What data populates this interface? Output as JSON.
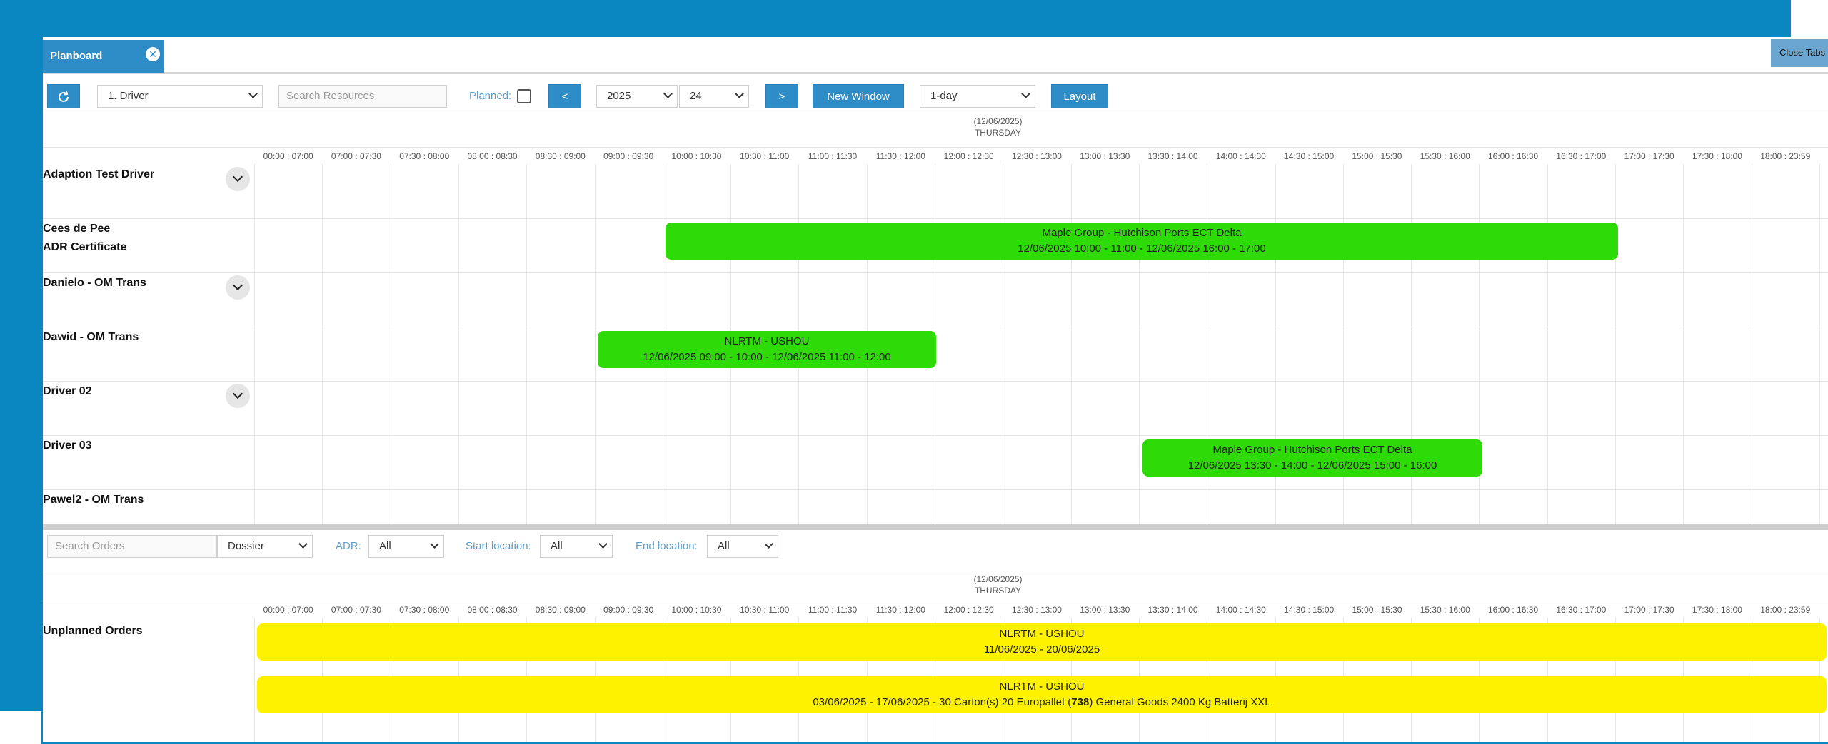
{
  "tab": {
    "title": "Planboard",
    "close_icon": "close-icon"
  },
  "close_tabs_label": "Close Tabs",
  "toolbar": {
    "resource_type": "1. Driver",
    "search_resources_placeholder": "Search Resources",
    "planned_label": "Planned:",
    "prev_label": "<",
    "year": "2025",
    "week": "24",
    "next_label": ">",
    "new_window_label": "New Window",
    "view_mode": "1-day",
    "layout_label": "Layout"
  },
  "date_header": {
    "date": "(12/06/2025)",
    "day": "THURSDAY"
  },
  "time_slots": [
    "00:00 : 07:00",
    "07:00 : 07:30",
    "07:30 : 08:00",
    "08:00 : 08:30",
    "08:30 : 09:00",
    "09:00 : 09:30",
    "10:00 : 10:30",
    "10:30 : 11:00",
    "11:00 : 11:30",
    "11:30 : 12:00",
    "12:00 : 12:30",
    "12:30 : 13:00",
    "13:00 : 13:30",
    "13:30 : 14:00",
    "14:00 : 14:30",
    "14:30 : 15:00",
    "15:00 : 15:30",
    "15:30 : 16:00",
    "16:00 : 16:30",
    "16:30 : 17:00",
    "17:00 : 17:30",
    "17:30 : 18:00",
    "18:00 : 23:59"
  ],
  "resources": [
    {
      "name": "Adaption Test Driver",
      "sub": ""
    },
    {
      "name": "Cees de Pee",
      "sub": "ADR Certificate"
    },
    {
      "name": "Danielo - OM Trans",
      "sub": ""
    },
    {
      "name": "Dawid - OM Trans",
      "sub": ""
    },
    {
      "name": "Driver 02",
      "sub": ""
    },
    {
      "name": "Driver 03",
      "sub": ""
    },
    {
      "name": "Pawel2 - OM Trans",
      "sub": ""
    }
  ],
  "planned_trips": [
    {
      "title": "Maple Group - Hutchison Ports ECT Delta",
      "period": "12/06/2025 10:00 - 11:00 - 12/06/2025 16:00 - 17:00"
    },
    {
      "title": "NLRTM - USHOU",
      "period": "12/06/2025 09:00 - 10:00 - 12/06/2025 11:00 - 12:00"
    },
    {
      "title": "Maple Group - Hutchison Ports ECT Delta",
      "period": "12/06/2025 13:30 - 14:00 - 12/06/2025 15:00 - 16:00"
    }
  ],
  "orders_toolbar": {
    "search_orders_placeholder": "Search Orders",
    "order_type": "Dossier",
    "adr_label": "ADR:",
    "adr_value": "All",
    "start_location_label": "Start location:",
    "start_location_value": "All",
    "end_location_label": "End location:",
    "end_location_value": "All"
  },
  "unplanned": {
    "label": "Unplanned Orders",
    "orders": [
      {
        "title": "NLRTM - USHOU",
        "details_pre": "11/06/2025 - 20/06/2025",
        "details_bold": "",
        "details_post": ""
      },
      {
        "title": "NLRTM - USHOU",
        "details_pre": "03/06/2025 - 17/06/2025 - 30 Carton(s) 20 Europallet (",
        "details_bold": "738",
        "details_post": ") General Goods 2400 Kg Batterij XXL"
      }
    ]
  },
  "colors": {
    "accent": "#2e8cc7",
    "planned_bar": "#2edb07",
    "unplanned_bar": "#fff200",
    "frame": "#0a86c1"
  },
  "icons": {
    "refresh": "refresh-icon",
    "chevron": "chevron-down-icon"
  }
}
